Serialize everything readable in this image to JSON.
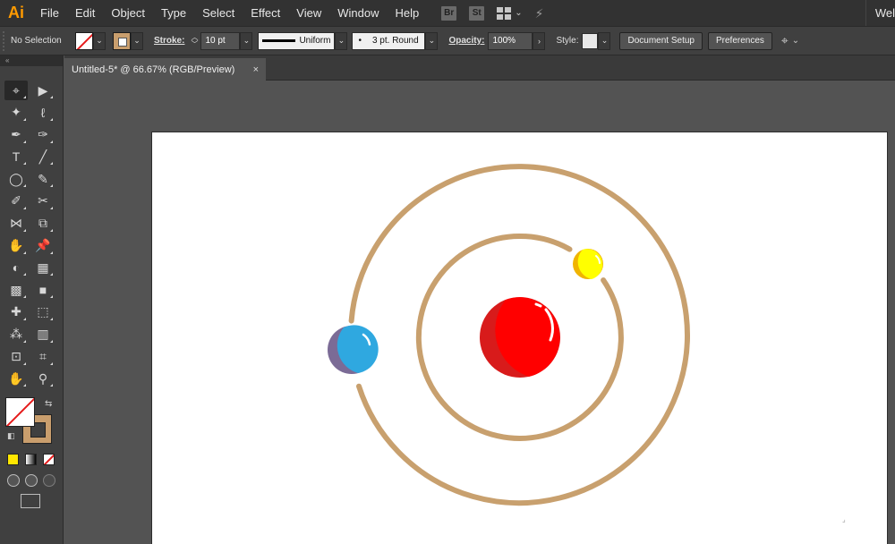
{
  "app": {
    "logo": "Ai"
  },
  "menu": [
    "File",
    "Edit",
    "Object",
    "Type",
    "Select",
    "Effect",
    "View",
    "Window",
    "Help"
  ],
  "menu_icons": {
    "bridge": "Br",
    "stock": "St"
  },
  "welcome": "Wel",
  "control_bar": {
    "selection_label": "No Selection",
    "stroke_label": "Stroke:",
    "stroke_weight": "10 pt",
    "profile": "Uniform",
    "brush": "3 pt. Round",
    "opacity_label": "Opacity:",
    "opacity": "100%",
    "style_label": "Style:",
    "document_setup": "Document Setup",
    "preferences": "Preferences"
  },
  "document_tab": {
    "title": "Untitled-5* @ 66.67% (RGB/Preview)",
    "close": "×"
  },
  "tools": [
    "selection-tool",
    "direct-selection-tool",
    "magic-wand-tool",
    "lasso-tool",
    "pen-tool",
    "curvature-tool",
    "type-tool",
    "line-segment-tool",
    "ellipse-tool",
    "paintbrush-tool",
    "shaper-tool",
    "scissors-tool",
    "reflect-tool",
    "scale-tool",
    "warp-tool",
    "puppet-warp-tool",
    "shape-builder-tool",
    "perspective-grid-tool",
    "mesh-tool",
    "gradient-tool",
    "eyedropper-tool",
    "blend-tool",
    "symbol-sprayer-tool",
    "column-graph-tool",
    "artboard-tool",
    "slice-tool",
    "hand-tool",
    "zoom-tool"
  ],
  "tool_glyphs": [
    "⌖",
    "▶",
    "✦",
    "ℓ",
    "✒",
    "✑",
    "T",
    "╱",
    "◯",
    "✎",
    "✐",
    "✂",
    "⋈",
    "⧉",
    "✋",
    "📌",
    "◐",
    "▦",
    "▩",
    "■",
    "✚",
    "⬚",
    "⁂",
    "▥",
    "⊡",
    "⌗",
    "✋",
    "⚲"
  ],
  "colors": {
    "stroke_swatch": "#c99e6d",
    "orbit": "#c8a06e",
    "sun": "#ff0000",
    "sun_shade": "#d81b1b",
    "yellow_planet": "#ffff00",
    "yellow_shade": "#f0b400",
    "blue_planet": "#2fa8e0",
    "blue_shade": "#7b6b96"
  }
}
